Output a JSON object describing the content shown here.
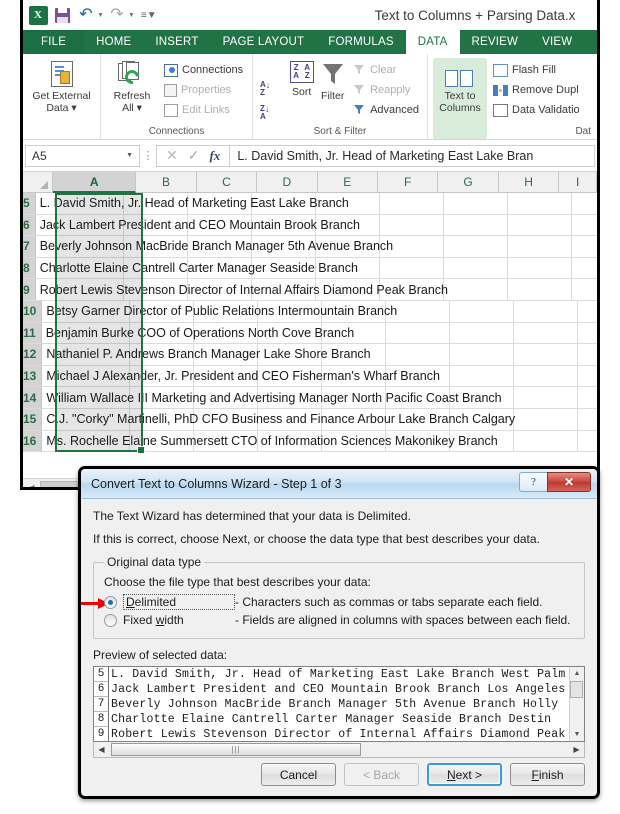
{
  "excel": {
    "title": "Text to Columns + Parsing Data.x",
    "qat": [
      {
        "name": "excel-logo",
        "label": "X"
      },
      {
        "name": "save-icon",
        "label": ""
      },
      {
        "name": "undo-icon",
        "label": "↶"
      },
      {
        "name": "redo-icon",
        "label": "↷"
      },
      {
        "name": "customize-qat-icon",
        "label": "▾"
      }
    ],
    "tabs": [
      {
        "label": "FILE",
        "active": false
      },
      {
        "label": "HOME",
        "active": false
      },
      {
        "label": "INSERT",
        "active": false
      },
      {
        "label": "PAGE LAYOUT",
        "active": false
      },
      {
        "label": "FORMULAS",
        "active": false
      },
      {
        "label": "DATA",
        "active": true
      },
      {
        "label": "REVIEW",
        "active": false
      },
      {
        "label": "VIEW",
        "active": false
      }
    ],
    "ribbon": {
      "groups": [
        {
          "label": "",
          "big": [
            {
              "label_line1": "Get External",
              "label_line2": "Data ▾"
            }
          ],
          "small": []
        },
        {
          "label": "Connections",
          "big": [
            {
              "label_line1": "Refresh",
              "label_line2": "All ▾"
            }
          ],
          "small": [
            {
              "label": "Connections",
              "disabled": false
            },
            {
              "label": "Properties",
              "disabled": true
            },
            {
              "label": "Edit Links",
              "disabled": true
            }
          ]
        },
        {
          "label": "Sort & Filter",
          "big": [
            {
              "label_line1": "Sort",
              "label_line2": ""
            },
            {
              "label_line1": "Filter",
              "label_line2": ""
            }
          ],
          "small": [
            {
              "label": "Clear",
              "disabled": true
            },
            {
              "label": "Reapply",
              "disabled": true
            },
            {
              "label": "Advanced",
              "disabled": false
            }
          ]
        },
        {
          "label": "Dat",
          "big": [
            {
              "label_line1": "Text to",
              "label_line2": "Columns"
            }
          ],
          "small": [
            {
              "label": "Flash Fill",
              "disabled": false
            },
            {
              "label": "Remove Dupl",
              "disabled": false
            },
            {
              "label": "Data Validatio",
              "disabled": false
            }
          ]
        }
      ]
    },
    "formula_bar": {
      "name_box": "A5",
      "cancel_icon": "✕",
      "enter_icon": "✓",
      "function_icon": "fx",
      "content": "L. David Smith, Jr. Head of Marketing East Lake Bran"
    },
    "grid": {
      "columns": [
        "A",
        "B",
        "C",
        "D",
        "E",
        "F",
        "G",
        "H",
        "I"
      ],
      "selected_column": "A",
      "rows": [
        {
          "num": "5",
          "text": "L. David Smith, Jr. Head of Marketing East Lake Branch"
        },
        {
          "num": "6",
          "text": "Jack Lambert President and CEO Mountain Brook Branch"
        },
        {
          "num": "7",
          "text": "Beverly Johnson MacBride Branch Manager 5th Avenue Branch"
        },
        {
          "num": "8",
          "text": "Charlotte Elaine Cantrell Carter Manager Seaside Branch"
        },
        {
          "num": "9",
          "text": "Robert Lewis Stevenson Director of Internal Affairs Diamond Peak Branch"
        },
        {
          "num": "10",
          "text": "Betsy Garner Director of Public Relations Intermountain Branch"
        },
        {
          "num": "11",
          "text": "Benjamin Burke COO of Operations North Cove Branch"
        },
        {
          "num": "12",
          "text": "Nathaniel P. Andrews Branch Manager Lake Shore Branch"
        },
        {
          "num": "13",
          "text": "Michael J Alexander, Jr. President and CEO Fisherman's Wharf Branch"
        },
        {
          "num": "14",
          "text": "William Wallace III Marketing and Advertising Manager North Pacific Coast Branch"
        },
        {
          "num": "15",
          "text": "C.J. \"Corky\" Martinelli, PhD CFO Business and Finance Arbour Lake Branch Calgary"
        },
        {
          "num": "16",
          "text": "Ms. Rochelle Elaine Summersett CTO of Information Sciences Makonikey Branch"
        }
      ]
    }
  },
  "wizard": {
    "title": "Convert Text to Columns Wizard - Step 1 of 3",
    "help_label": "?",
    "close_label": "✕",
    "intro_line1": "The Text Wizard has determined that your data is Delimited.",
    "intro_line2": "If this is correct, choose Next, or choose the data type that best describes your data.",
    "group_legend": "Original data type",
    "group_sub": "Choose the file type that best describes your data:",
    "options": [
      {
        "label": "Delimited",
        "underline": "D",
        "desc": "- Characters such as commas or tabs separate each field.",
        "selected": true
      },
      {
        "label": "Fixed width",
        "underline": "w",
        "desc": "- Fields are aligned in columns with spaces between each field.",
        "selected": false
      }
    ],
    "preview_label": "Preview of selected data:",
    "preview_rows": [
      {
        "num": "5",
        "text": "L. David Smith, Jr. Head of Marketing East Lake Branch West Palm"
      },
      {
        "num": "6",
        "text": "Jack Lambert President and CEO Mountain Brook Branch Los Angeles"
      },
      {
        "num": "7",
        "text": "Beverly Johnson MacBride Branch Manager 5th Avenue Branch Holly"
      },
      {
        "num": "8",
        "text": "Charlotte Elaine Cantrell Carter Manager Seaside Branch Destin"
      },
      {
        "num": "9",
        "text": "Robert Lewis Stevenson Director of Internal Affairs Diamond Peak"
      }
    ],
    "buttons": [
      {
        "label": "Cancel",
        "state": "normal"
      },
      {
        "label": "< Back",
        "state": "disabled"
      },
      {
        "label": "Next >",
        "state": "default"
      },
      {
        "label": "Finish",
        "state": "normal"
      }
    ]
  },
  "annotation": {
    "arrow_color": "#ee0000"
  }
}
